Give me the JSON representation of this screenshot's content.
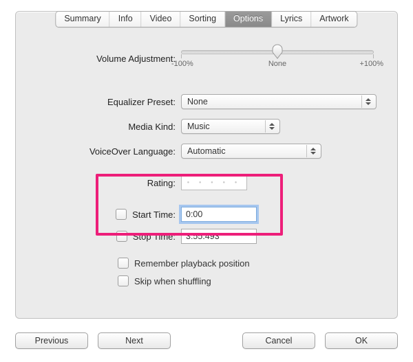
{
  "tabs": {
    "summary": "Summary",
    "info": "Info",
    "video": "Video",
    "sorting": "Sorting",
    "options": "Options",
    "lyrics": "Lyrics",
    "artwork": "Artwork",
    "selected": "options"
  },
  "labels": {
    "volume": "Volume Adjustment:",
    "eq": "Equalizer Preset:",
    "media": "Media Kind:",
    "voice": "VoiceOver Language:",
    "rating": "Rating:",
    "start": "Start Time:",
    "stop": "Stop Time:",
    "remember": "Remember playback position",
    "skip": "Skip when shuffling"
  },
  "slider": {
    "min": "-100%",
    "mid": "None",
    "max": "+100%"
  },
  "values": {
    "eq": "None",
    "media": "Music",
    "voice": "Automatic",
    "start": "0:00",
    "stop": "3:55.493"
  },
  "buttons": {
    "previous": "Previous",
    "next": "Next",
    "cancel": "Cancel",
    "ok": "OK"
  }
}
